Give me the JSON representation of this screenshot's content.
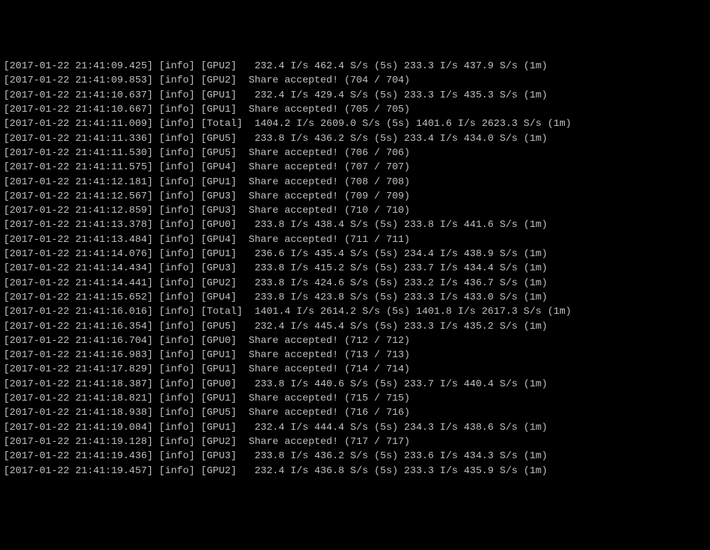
{
  "lines": [
    {
      "ts": "2017-01-22 21:41:09.425",
      "level": "info",
      "src": "GPU2",
      "msg": "  232.4 I/s 462.4 S/s (5s) 233.3 I/s 437.9 S/s (1m)"
    },
    {
      "ts": "2017-01-22 21:41:09.853",
      "level": "info",
      "src": "GPU2",
      "msg": " Share accepted! (704 / 704)"
    },
    {
      "ts": "2017-01-22 21:41:10.637",
      "level": "info",
      "src": "GPU1",
      "msg": "  232.4 I/s 429.4 S/s (5s) 233.3 I/s 435.3 S/s (1m)"
    },
    {
      "ts": "2017-01-22 21:41:10.667",
      "level": "info",
      "src": "GPU1",
      "msg": " Share accepted! (705 / 705)"
    },
    {
      "ts": "2017-01-22 21:41:11.009",
      "level": "info",
      "src": "Total",
      "msg": "  1404.2 I/s 2609.0 S/s (5s) 1401.6 I/s 2623.3 S/s (1m)"
    },
    {
      "ts": "2017-01-22 21:41:11.336",
      "level": "info",
      "src": "GPU5",
      "msg": "  233.8 I/s 436.2 S/s (5s) 233.4 I/s 434.0 S/s (1m)"
    },
    {
      "ts": "2017-01-22 21:41:11.530",
      "level": "info",
      "src": "GPU5",
      "msg": " Share accepted! (706 / 706)"
    },
    {
      "ts": "2017-01-22 21:41:11.575",
      "level": "info",
      "src": "GPU4",
      "msg": " Share accepted! (707 / 707)"
    },
    {
      "ts": "2017-01-22 21:41:12.181",
      "level": "info",
      "src": "GPU1",
      "msg": " Share accepted! (708 / 708)"
    },
    {
      "ts": "2017-01-22 21:41:12.567",
      "level": "info",
      "src": "GPU3",
      "msg": " Share accepted! (709 / 709)"
    },
    {
      "ts": "2017-01-22 21:41:12.859",
      "level": "info",
      "src": "GPU3",
      "msg": " Share accepted! (710 / 710)"
    },
    {
      "ts": "2017-01-22 21:41:13.378",
      "level": "info",
      "src": "GPU0",
      "msg": "  233.8 I/s 438.4 S/s (5s) 233.8 I/s 441.6 S/s (1m)"
    },
    {
      "ts": "2017-01-22 21:41:13.484",
      "level": "info",
      "src": "GPU4",
      "msg": " Share accepted! (711 / 711)"
    },
    {
      "ts": "2017-01-22 21:41:14.076",
      "level": "info",
      "src": "GPU1",
      "msg": "  236.6 I/s 435.4 S/s (5s) 234.4 I/s 438.9 S/s (1m)"
    },
    {
      "ts": "2017-01-22 21:41:14.434",
      "level": "info",
      "src": "GPU3",
      "msg": "  233.8 I/s 415.2 S/s (5s) 233.7 I/s 434.4 S/s (1m)"
    },
    {
      "ts": "2017-01-22 21:41:14.441",
      "level": "info",
      "src": "GPU2",
      "msg": "  233.8 I/s 424.6 S/s (5s) 233.2 I/s 436.7 S/s (1m)"
    },
    {
      "ts": "2017-01-22 21:41:15.652",
      "level": "info",
      "src": "GPU4",
      "msg": "  233.8 I/s 423.8 S/s (5s) 233.3 I/s 433.0 S/s (1m)"
    },
    {
      "ts": "2017-01-22 21:41:16.016",
      "level": "info",
      "src": "Total",
      "msg": "  1401.4 I/s 2614.2 S/s (5s) 1401.8 I/s 2617.3 S/s (1m)"
    },
    {
      "ts": "2017-01-22 21:41:16.354",
      "level": "info",
      "src": "GPU5",
      "msg": "  232.4 I/s 445.4 S/s (5s) 233.3 I/s 435.2 S/s (1m)"
    },
    {
      "ts": "2017-01-22 21:41:16.704",
      "level": "info",
      "src": "GPU0",
      "msg": " Share accepted! (712 / 712)"
    },
    {
      "ts": "2017-01-22 21:41:16.983",
      "level": "info",
      "src": "GPU1",
      "msg": " Share accepted! (713 / 713)"
    },
    {
      "ts": "2017-01-22 21:41:17.829",
      "level": "info",
      "src": "GPU1",
      "msg": " Share accepted! (714 / 714)"
    },
    {
      "ts": "2017-01-22 21:41:18.387",
      "level": "info",
      "src": "GPU0",
      "msg": "  233.8 I/s 440.6 S/s (5s) 233.7 I/s 440.4 S/s (1m)"
    },
    {
      "ts": "2017-01-22 21:41:18.821",
      "level": "info",
      "src": "GPU1",
      "msg": " Share accepted! (715 / 715)"
    },
    {
      "ts": "2017-01-22 21:41:18.938",
      "level": "info",
      "src": "GPU5",
      "msg": " Share accepted! (716 / 716)"
    },
    {
      "ts": "2017-01-22 21:41:19.084",
      "level": "info",
      "src": "GPU1",
      "msg": "  232.4 I/s 444.4 S/s (5s) 234.3 I/s 438.6 S/s (1m)"
    },
    {
      "ts": "2017-01-22 21:41:19.128",
      "level": "info",
      "src": "GPU2",
      "msg": " Share accepted! (717 / 717)"
    },
    {
      "ts": "2017-01-22 21:41:19.436",
      "level": "info",
      "src": "GPU3",
      "msg": "  233.8 I/s 436.2 S/s (5s) 233.6 I/s 434.3 S/s (1m)"
    },
    {
      "ts": "2017-01-22 21:41:19.457",
      "level": "info",
      "src": "GPU2",
      "msg": "  232.4 I/s 436.8 S/s (5s) 233.3 I/s 435.9 S/s (1m)"
    }
  ]
}
